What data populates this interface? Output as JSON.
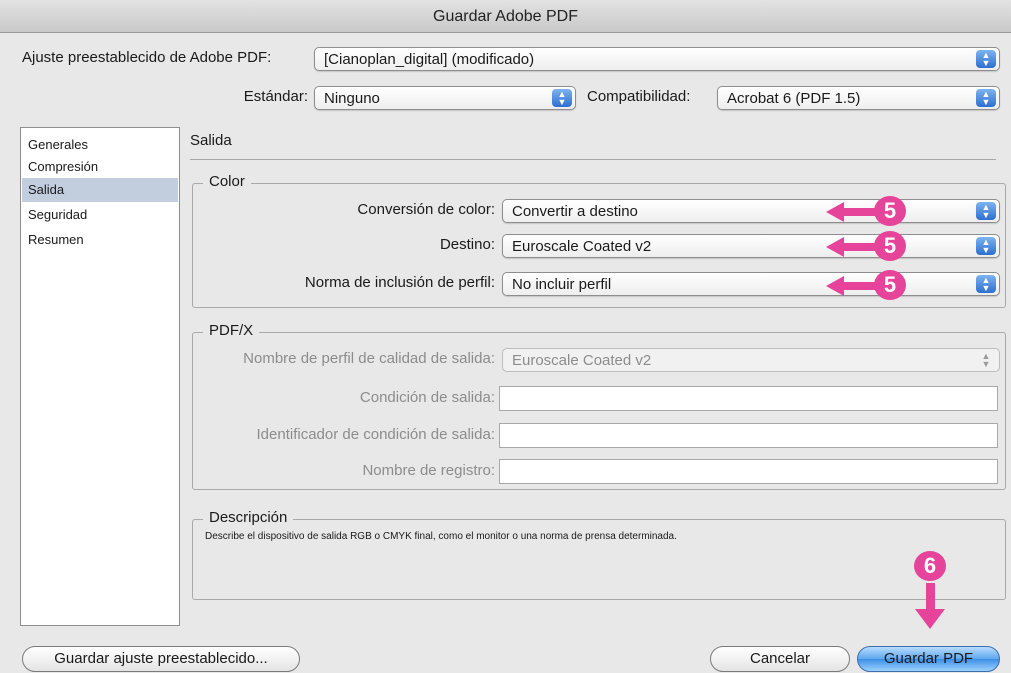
{
  "window": {
    "title": "Guardar Adobe PDF"
  },
  "top": {
    "preset_label": "Ajuste preestablecido de Adobe PDF:",
    "preset_value": "[Cianoplan_digital] (modificado)",
    "standard_label": "Estándar:",
    "standard_value": "Ninguno",
    "compat_label": "Compatibilidad:",
    "compat_value": "Acrobat 6 (PDF 1.5)"
  },
  "sidebar": {
    "items": [
      {
        "label": "Generales"
      },
      {
        "label": "Compresión"
      },
      {
        "label": "Salida"
      },
      {
        "label": "Seguridad"
      },
      {
        "label": "Resumen"
      }
    ],
    "selected": "Salida"
  },
  "pane": {
    "title": "Salida"
  },
  "color_group": {
    "title": "Color",
    "conversion_label": "Conversión de color:",
    "conversion_value": "Convertir a destino",
    "destination_label": "Destino:",
    "destination_value": "Euroscale Coated v2",
    "profile_label": "Norma de inclusión de perfil:",
    "profile_value": "No incluir perfil"
  },
  "pdfx_group": {
    "title": "PDF/X",
    "profile_name_label": "Nombre de perfil de calidad de salida:",
    "profile_name_value": "Euroscale Coated v2",
    "condition_label": "Condición de salida:",
    "condition_value": "",
    "condition_id_label": "Identificador de condición de salida:",
    "condition_id_value": "",
    "registry_label": "Nombre de registro:",
    "registry_value": ""
  },
  "description": {
    "title": "Descripción",
    "text": "Describe el dispositivo de salida RGB o CMYK final, como el monitor o una norma de prensa determinada."
  },
  "buttons": {
    "save_preset": "Guardar ajuste preestablecido...",
    "cancel": "Cancelar",
    "save_pdf": "Guardar PDF"
  },
  "annotations": {
    "step5": "5",
    "step6": "6",
    "color": "#e6439b"
  },
  "colors": {
    "selection": "#c2cddd",
    "accent": "#3d8fe6"
  }
}
